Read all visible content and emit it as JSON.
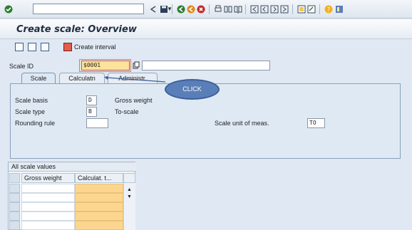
{
  "toolbar": {
    "icons": [
      "check-icon",
      "dropdown-icon",
      "back-arrow-icon",
      "save-icon",
      "green-back-icon",
      "exit-icon",
      "cancel-icon",
      "print-icon",
      "find-icon",
      "find-next-icon",
      "first-page-icon",
      "prev-page-icon",
      "next-page-icon",
      "last-page-icon",
      "new-session-icon",
      "shortcut-icon",
      "help-icon",
      "layout-icon"
    ],
    "command_value": ""
  },
  "title": "Create scale: Overview",
  "app_toolbar": {
    "icons": [
      "details-icon",
      "new-icon",
      "delete-icon",
      "create-interval-icon"
    ],
    "create_interval_label": "Create interval"
  },
  "scale_id": {
    "label": "Scale ID",
    "value": "$0001",
    "long_field_value": ""
  },
  "tabs": [
    {
      "label": "Scale",
      "active": true
    },
    {
      "label": "Calculatn",
      "active": false
    },
    {
      "label": "Administr.",
      "active": false
    }
  ],
  "callout": {
    "label": "CLICK"
  },
  "scale_tab": {
    "scale_basis": {
      "label": "Scale basis",
      "value": "D",
      "desc": "Gross weight"
    },
    "scale_type": {
      "label": "Scale type",
      "value": "B",
      "desc": "To-scale"
    },
    "rounding_rule": {
      "label": "Rounding rule",
      "value": ""
    },
    "scale_unit": {
      "label": "Scale unit of meas.",
      "value": "TO"
    }
  },
  "scale_values_table": {
    "title": "All scale values",
    "columns": [
      "Gross weight",
      "Calculat. t..."
    ],
    "rows": [
      [
        "",
        ""
      ],
      [
        "",
        ""
      ],
      [
        "",
        ""
      ],
      [
        "",
        ""
      ],
      [
        "",
        ""
      ]
    ]
  }
}
